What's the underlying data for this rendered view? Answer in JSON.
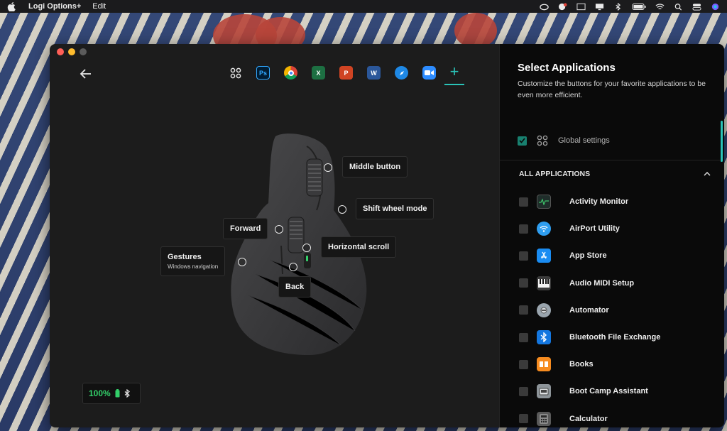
{
  "menubar": {
    "app_name": "Logi Options+",
    "menu_edit": "Edit",
    "tray_icons": [
      "creative-cloud-icon",
      "notification-icon",
      "nhk-icon",
      "display-icon",
      "bluetooth-icon",
      "battery-icon",
      "wifi-icon",
      "search-icon",
      "control-center-icon",
      "siri-icon"
    ]
  },
  "app_tabs": [
    {
      "name": "global-apps-icon",
      "label": "",
      "color": "#1c1c1c"
    },
    {
      "name": "photoshop-icon",
      "label": "Ps",
      "color": "#001d34"
    },
    {
      "name": "chrome-icon",
      "label": "",
      "color": "#db4437"
    },
    {
      "name": "excel-icon",
      "label": "X",
      "color": "#1d6f42"
    },
    {
      "name": "powerpoint-icon",
      "label": "P",
      "color": "#d04423"
    },
    {
      "name": "word-icon",
      "label": "W",
      "color": "#2b579a"
    },
    {
      "name": "safari-icon",
      "label": "",
      "color": "#1e88e5"
    },
    {
      "name": "zoom-icon",
      "label": "",
      "color": "#2d8cff"
    }
  ],
  "mouse_buttons": {
    "middle": "Middle button",
    "shift_wheel": "Shift wheel mode",
    "forward": "Forward",
    "horizontal_scroll": "Horizontal scroll",
    "gestures": "Gestures",
    "gestures_sub": "Windows navigation",
    "back": "Back"
  },
  "battery": {
    "percent": "100%"
  },
  "panel": {
    "title": "Select Applications",
    "description": "Customize the buttons for your favorite applications to be even more efficient.",
    "global_label": "Global settings",
    "section_title": "ALL APPLICATIONS",
    "apps": [
      {
        "name": "Activity Monitor",
        "icon": "activity-monitor-icon",
        "color": "#1f2d2a"
      },
      {
        "name": "AirPort Utility",
        "icon": "airport-utility-icon",
        "color": "#2f9ef0"
      },
      {
        "name": "App Store",
        "icon": "app-store-icon",
        "color": "#1a8cf2"
      },
      {
        "name": "Audio MIDI Setup",
        "icon": "audio-midi-icon",
        "color": "#3a3a3a"
      },
      {
        "name": "Automator",
        "icon": "automator-icon",
        "color": "#9aa5ae"
      },
      {
        "name": "Bluetooth File Exchange",
        "icon": "bluetooth-file-exchange-icon",
        "color": "#1477e0"
      },
      {
        "name": "Books",
        "icon": "books-icon",
        "color": "#f68b1f"
      },
      {
        "name": "Boot Camp Assistant",
        "icon": "boot-camp-icon",
        "color": "#8d9499"
      },
      {
        "name": "Calculator",
        "icon": "calculator-icon",
        "color": "#5a5a5a"
      }
    ]
  }
}
